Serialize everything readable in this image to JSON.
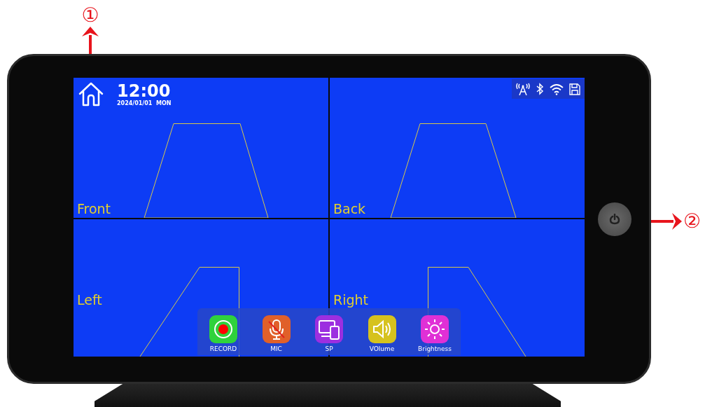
{
  "callouts": [
    {
      "label": "①"
    },
    {
      "label": "②"
    }
  ],
  "screen": {
    "time": "12:00",
    "date": "2024/01/01  MON",
    "cameras": [
      {
        "label": "Front",
        "kind": "front"
      },
      {
        "label": "Back",
        "kind": "back"
      },
      {
        "label": "Left",
        "kind": "left"
      },
      {
        "label": "Right",
        "kind": "right"
      }
    ],
    "dock": [
      {
        "label": "RECORD",
        "kind": "record",
        "color": "#2fd23c"
      },
      {
        "label": "MIC",
        "kind": "mic",
        "color": "#e0602a"
      },
      {
        "label": "SP",
        "kind": "screen",
        "color": "#9c2fe0"
      },
      {
        "label": "VOlume",
        "kind": "volume",
        "color": "#d6c21e"
      },
      {
        "label": "Brightness",
        "kind": "brightness",
        "color": "#e030d6"
      }
    ]
  }
}
